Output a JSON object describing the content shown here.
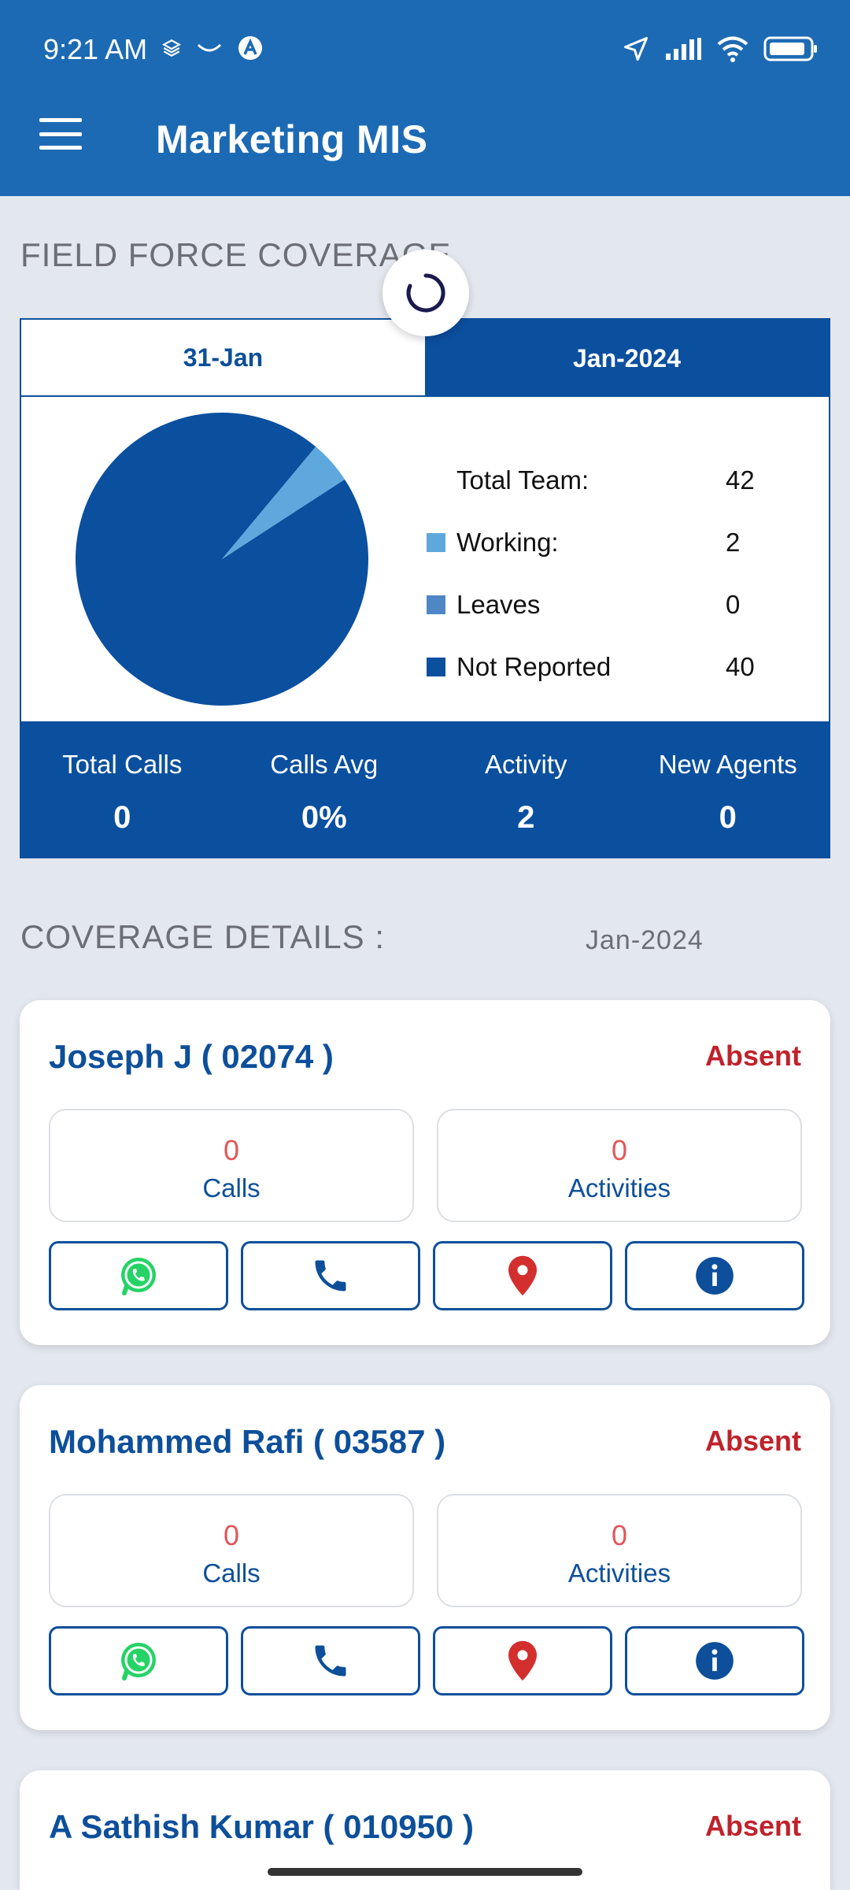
{
  "status_bar": {
    "time": "9:21 AM"
  },
  "app_bar": {
    "title": "Marketing MIS"
  },
  "field_force": {
    "section_title": "FIELD FORCE COVERAGE",
    "tabs": [
      {
        "label": "31-Jan",
        "active": false
      },
      {
        "label": "Jan-2024",
        "active": true
      }
    ],
    "legend": [
      {
        "label": "Total Team:",
        "value": "42",
        "color": ""
      },
      {
        "label": "Working:",
        "value": "2",
        "color": "#5ea8dd"
      },
      {
        "label": "Leaves",
        "value": "0",
        "color": "#4f86c6"
      },
      {
        "label": "Not Reported",
        "value": "40",
        "color": "#0b4f9f"
      }
    ],
    "stats": [
      {
        "label": "Total Calls",
        "value": "0"
      },
      {
        "label": "Calls Avg",
        "value": "0%"
      },
      {
        "label": "Activity",
        "value": "2"
      },
      {
        "label": "New Agents",
        "value": "0"
      }
    ]
  },
  "chart_data": {
    "type": "pie",
    "labels": [
      "Working",
      "Leaves",
      "Not Reported"
    ],
    "values": [
      2,
      0,
      40
    ],
    "colors": [
      "#5ea8dd",
      "#4f86c6",
      "#0b4f9f"
    ]
  },
  "coverage_details": {
    "section_title": "COVERAGE DETAILS :",
    "month": "Jan-2024",
    "agents": [
      {
        "name": "Joseph J ( 02074 )",
        "status": "Absent",
        "calls_value": "0",
        "calls_label": "Calls",
        "activities_value": "0",
        "activities_label": "Activities"
      },
      {
        "name": "Mohammed Rafi ( 03587 )",
        "status": "Absent",
        "calls_value": "0",
        "calls_label": "Calls",
        "activities_value": "0",
        "activities_label": "Activities"
      },
      {
        "name": "A Sathish Kumar ( 010950 )",
        "status": "Absent"
      }
    ]
  },
  "colors": {
    "primary": "#1d6ab4",
    "dark_blue": "#0b4f9f",
    "absent_red": "#c0222b",
    "metric_red": "#e0575a",
    "whatsapp_green": "#25d366",
    "location_red": "#d32f2f"
  }
}
